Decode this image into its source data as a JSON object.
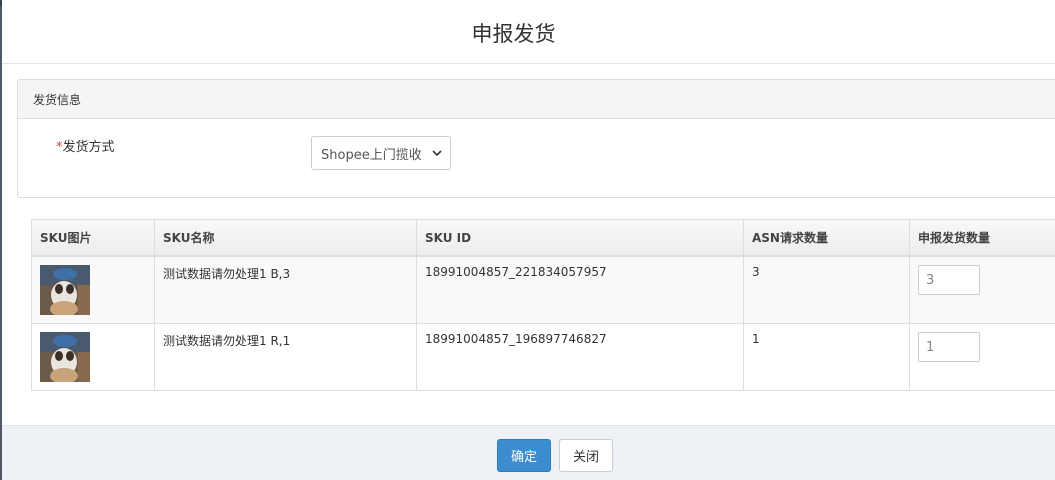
{
  "modal": {
    "title": "申报发货"
  },
  "panel": {
    "heading": "发货信息",
    "field_required_mark": "*",
    "field_label": "发货方式",
    "select_value": "Shopee上门揽收"
  },
  "table": {
    "headers": [
      "SKU图片",
      "SKU名称",
      "SKU ID",
      "ASN请求数量",
      "申报发货数量"
    ],
    "rows": [
      {
        "name": "测试数据请勿处理1 B,3",
        "sku_id": "18991004857_221834057957",
        "asn_qty": "3",
        "declare_qty": "3"
      },
      {
        "name": "测试数据请勿处理1 R,1",
        "sku_id": "18991004857_196897746827",
        "asn_qty": "1",
        "declare_qty": "1"
      }
    ]
  },
  "footer": {
    "confirm_label": "确定",
    "close_label": "关闭"
  },
  "colors": {
    "primary": "#3c8dd0",
    "required": "#e03a3a"
  }
}
